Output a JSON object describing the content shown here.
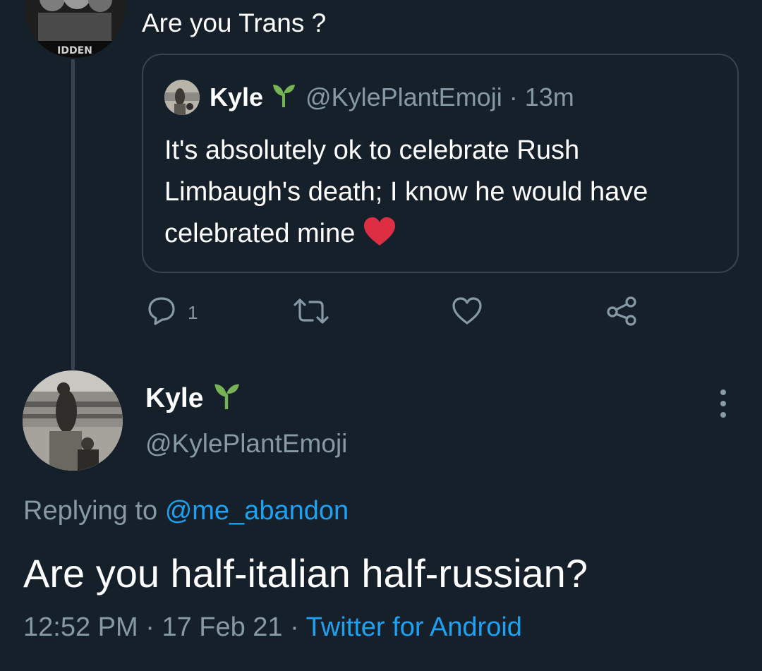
{
  "parent_tweet": {
    "text": "Are you Trans ?"
  },
  "quoted_tweet": {
    "name": "Kyle",
    "handle": "@KylePlantEmoji",
    "separator": "·",
    "time": "13m",
    "body": "It's absolutely ok to celebrate Rush Limbaugh's death; I know he would have celebrated mine",
    "emoji": "heart-emoji"
  },
  "actions": {
    "reply_count": "1",
    "icons": [
      "reply-icon",
      "retweet-icon",
      "like-icon",
      "share-icon"
    ]
  },
  "main_tweet": {
    "name": "Kyle",
    "name_emoji": "sprout-emoji",
    "handle": "@KylePlantEmoji",
    "replying_prefix": "Replying to",
    "replying_to": "@me_abandon",
    "text": "Are you half-italian half-russian?",
    "time": "12:52 PM",
    "separator": "·",
    "date": "17 Feb 21",
    "source": "Twitter for Android"
  },
  "colors": {
    "background": "#15202b",
    "text": "#ffffff",
    "secondary": "#8899a6",
    "link": "#1da1f2",
    "border": "#38444d",
    "sprout": "#77b255",
    "heart": "#dd2e44"
  }
}
